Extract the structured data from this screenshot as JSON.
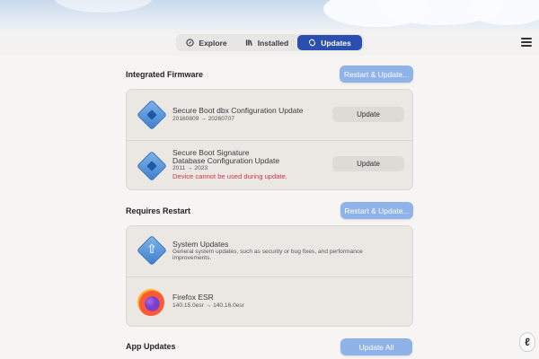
{
  "tabs": [
    {
      "label": "Explore",
      "icon": "compass-icon",
      "active": false
    },
    {
      "label": "Installed",
      "icon": "library-icon",
      "active": false
    },
    {
      "label": "Updates",
      "icon": "updates-icon",
      "active": true
    }
  ],
  "colors": {
    "accent": "#2b4fb0",
    "pill": "#8fb3e8",
    "warning": "#d6334a"
  },
  "integrated_firmware": {
    "title": "Integrated Firmware",
    "action_label": "Restart & Update...",
    "items": [
      {
        "name": "Secure Boot dbx Configuration Update",
        "version": "20160809 → 20260707",
        "button": "Update"
      },
      {
        "name_line1": "Secure Boot Signature",
        "name_line2": "Database Configuration Update",
        "version": "2011 → 2023",
        "warning": "Device cannot be used during update.",
        "button": "Update"
      }
    ]
  },
  "requires_restart": {
    "title": "Requires Restart",
    "action_label": "Restart & Update...",
    "items": [
      {
        "name": "System Updates",
        "desc_line1": "General system updates, such as security or bug fixes, and performance",
        "desc_line2": "improvements."
      },
      {
        "name": "Firefox ESR",
        "version": "140.15.0esr → 140.16.0esr"
      }
    ]
  },
  "app_updates": {
    "title": "App Updates",
    "action_label": "Update All"
  }
}
